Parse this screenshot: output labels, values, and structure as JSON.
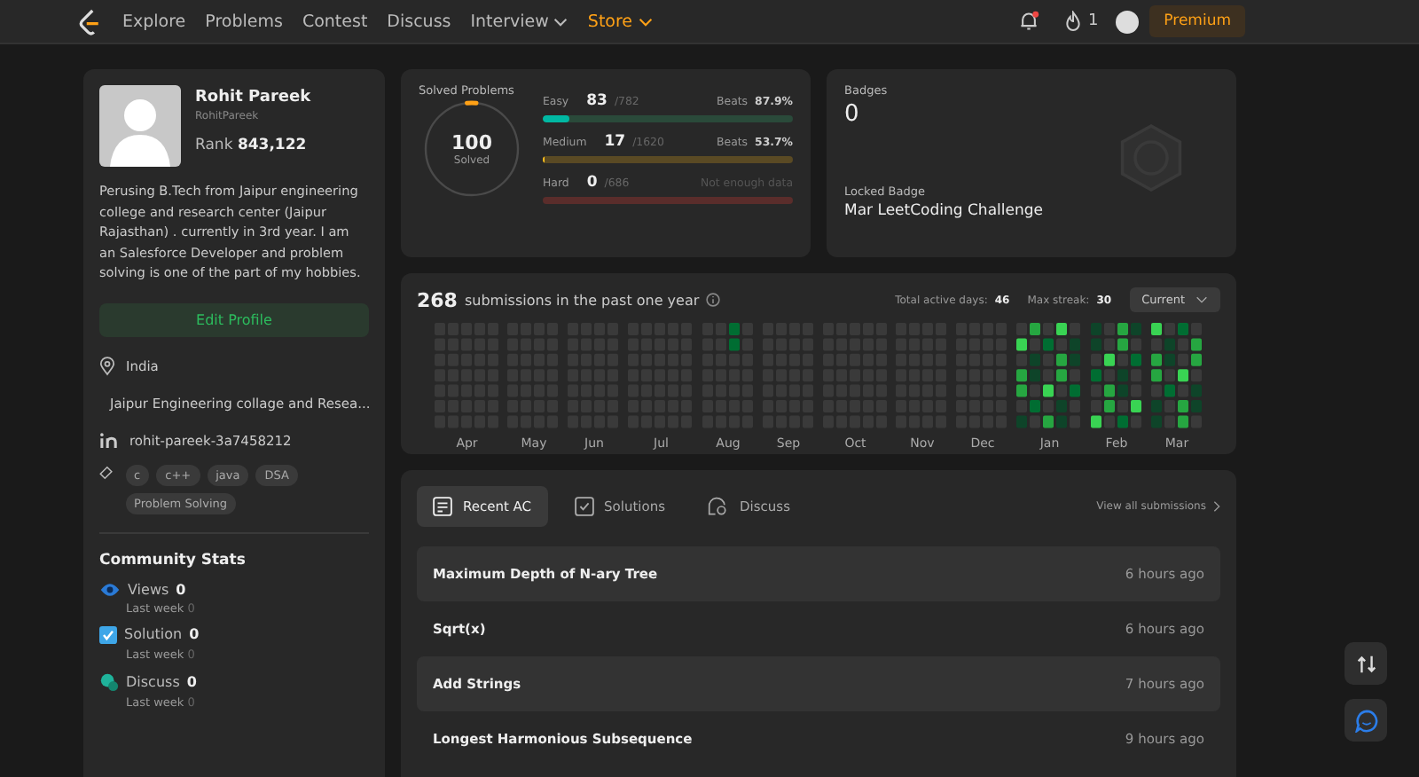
{
  "nav": {
    "items": [
      {
        "label": "Explore",
        "dropdown": false,
        "accent": false
      },
      {
        "label": "Problems",
        "dropdown": false,
        "accent": false
      },
      {
        "label": "Contest",
        "dropdown": false,
        "accent": false
      },
      {
        "label": "Discuss",
        "dropdown": false,
        "accent": false
      },
      {
        "label": "Interview",
        "dropdown": true,
        "accent": false
      },
      {
        "label": "Store",
        "dropdown": true,
        "accent": true
      }
    ],
    "notification_dot": true,
    "streak": "1",
    "premium": "Premium"
  },
  "profile": {
    "name": "Rohit Pareek",
    "username": "RohitPareek",
    "rank_label": "Rank",
    "rank": "843,122",
    "bio": "Perusing B.Tech from Jaipur engineering college and research center (Jaipur Rajasthan) . currently in 3rd year. I am an Salesforce Developer and problem solving is one of the part of my hobbies.",
    "edit_button": "Edit Profile",
    "info": [
      {
        "kind": "location",
        "text": "India"
      },
      {
        "kind": "school",
        "text": "Jaipur Engineering collage and Resea..."
      },
      {
        "kind": "linkedin",
        "text": "rohit-pareek-3a7458212"
      }
    ],
    "tags": [
      "c",
      "c++",
      "java",
      "DSA",
      "Problem Solving"
    ]
  },
  "community": {
    "title": "Community Stats",
    "stats": [
      {
        "kind": "views",
        "label": "Views",
        "value": "0",
        "sub_label": "Last week",
        "sub_value": "0"
      },
      {
        "kind": "solution",
        "label": "Solution",
        "value": "0",
        "sub_label": "Last week",
        "sub_value": "0"
      },
      {
        "kind": "discuss",
        "label": "Discuss",
        "value": "0",
        "sub_label": "Last week",
        "sub_value": "0"
      }
    ]
  },
  "solved": {
    "title": "Solved Problems",
    "count": "100",
    "count_label": "Solved",
    "level": 0.032,
    "difficulties": [
      {
        "kind": "easy",
        "label": "Easy",
        "solved": "83",
        "total": "/782",
        "beats_label": "Beats",
        "beats": "87.9%",
        "level": 0.106
      },
      {
        "kind": "medium",
        "label": "Medium",
        "solved": "17",
        "total": "/1620",
        "beats_label": "Beats",
        "beats": "53.7%",
        "level": 0.0105
      },
      {
        "kind": "hard",
        "label": "Hard",
        "solved": "0",
        "total": "/686",
        "beats": "Not enough data",
        "level": 0
      }
    ]
  },
  "badges": {
    "title": "Badges",
    "count": "0",
    "locked_label": "Locked Badge",
    "locked_name": "Mar LeetCoding Challenge"
  },
  "submissions": {
    "count": "268",
    "text": "submissions in the past one year",
    "active_label": "Total active days:",
    "active": "46",
    "streak_label": "Max streak:",
    "streak": "30",
    "period": "Current",
    "months": [
      "Apr",
      "May",
      "Jun",
      "Jul",
      "Aug",
      "Sep",
      "Oct",
      "Nov",
      "Dec",
      "Jan",
      "Feb",
      "Mar"
    ]
  },
  "recent": {
    "tabs": [
      {
        "kind": "recent",
        "label": "Recent AC",
        "selected": true
      },
      {
        "kind": "solutions",
        "label": "Solutions",
        "selected": false
      },
      {
        "kind": "discuss",
        "label": "Discuss",
        "selected": false
      }
    ],
    "view_all": "View all submissions",
    "rows": [
      {
        "title": "Maximum Depth of N-ary Tree",
        "time": "6 hours ago"
      },
      {
        "title": "Sqrt(x)",
        "time": "6 hours ago"
      },
      {
        "title": "Add Strings",
        "time": "7 hours ago"
      },
      {
        "title": "Longest Harmonious Subsequence",
        "time": "9 hours ago"
      }
    ]
  }
}
